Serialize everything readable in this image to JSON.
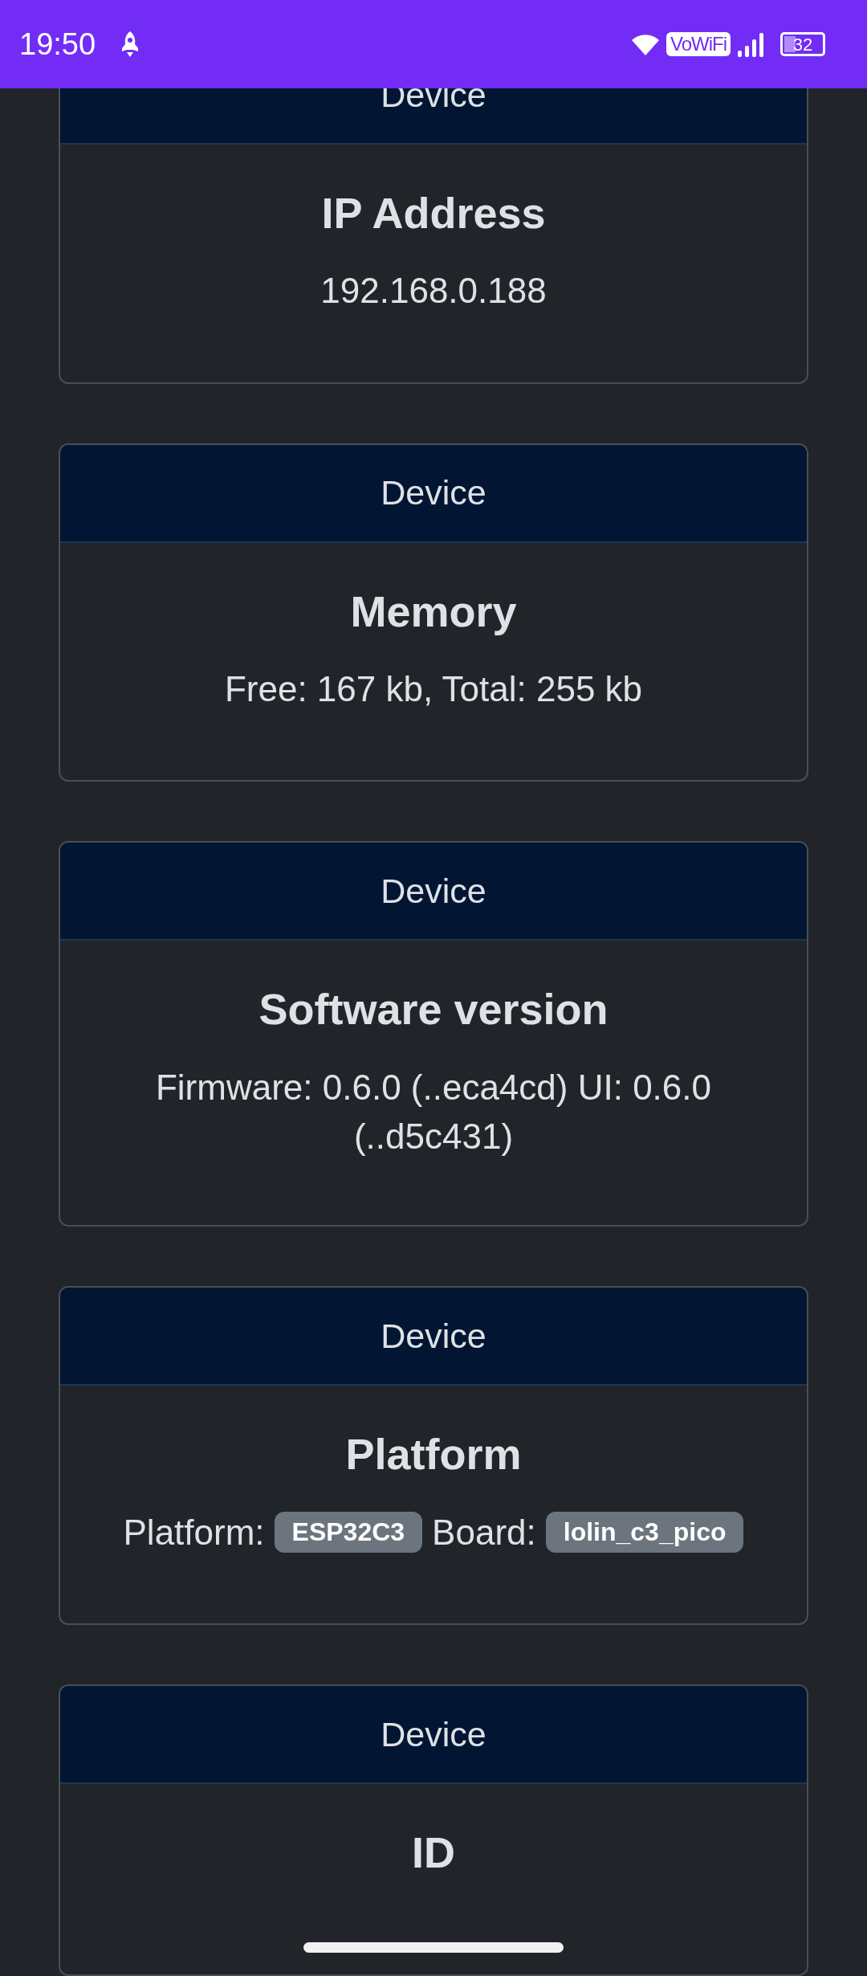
{
  "status_bar": {
    "time": "19:50",
    "network_label": "VoWiFi",
    "battery": "32"
  },
  "cards": [
    {
      "header": "Device",
      "title": "IP Address",
      "content": [
        {
          "kind": "text",
          "text": "192.168.0.188"
        }
      ]
    },
    {
      "header": "Device",
      "title": "Memory",
      "content": [
        {
          "kind": "text",
          "text": "Free: 167 kb, Total: 255 kb"
        }
      ]
    },
    {
      "header": "Device",
      "title": "Software version",
      "content": [
        {
          "kind": "text",
          "text": "Firmware: 0.6.0 (..eca4cd) UI: 0.6.0 (..d5c431)"
        }
      ]
    },
    {
      "header": "Device",
      "title": "Platform",
      "content": [
        {
          "kind": "text",
          "text": "Platform:"
        },
        {
          "kind": "badge",
          "text": "ESP32C3"
        },
        {
          "kind": "text",
          "text": "Board:"
        },
        {
          "kind": "badge",
          "text": "lolin_c3_pico"
        }
      ]
    },
    {
      "header": "Device",
      "title": "ID"
    }
  ]
}
